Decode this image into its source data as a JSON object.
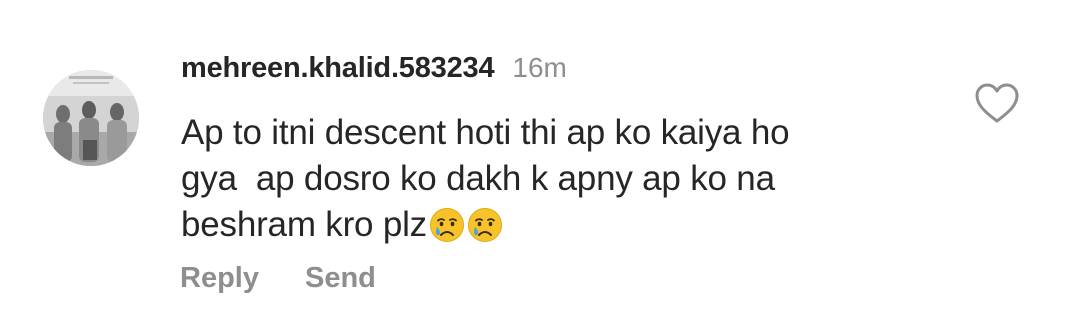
{
  "comment": {
    "username": "mehreen.khalid.583234",
    "timestamp": "16m",
    "lines": [
      "Ap to itni descent hoti thi ap ko kaiya ho",
      "gya  ap dosro ko dakh k apny ap ko na",
      "beshram kro plz"
    ],
    "emojis": [
      "crying-face",
      "crying-face"
    ],
    "actions": {
      "reply_label": "Reply",
      "send_label": "Send"
    },
    "like_icon": "heart-outline-icon"
  },
  "colors": {
    "text": "#262626",
    "secondary": "#8e8e8e",
    "background": "#ffffff"
  }
}
